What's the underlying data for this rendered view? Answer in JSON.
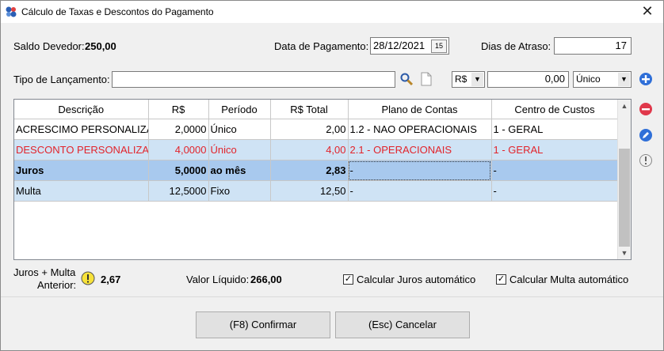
{
  "window": {
    "title": "Cálculo de Taxas e Descontos do Pagamento"
  },
  "header": {
    "saldo_label": "Saldo Devedor:",
    "saldo_value": "250,00",
    "data_label": "Data de Pagamento:",
    "data_value": "28/12/2021",
    "cal_day": "15",
    "dias_label": "Dias de Atraso:",
    "dias_value": "17"
  },
  "tipo": {
    "label": "Tipo de Lançamento:",
    "value": "",
    "currency": "R$",
    "amount": "0,00",
    "period": "Único"
  },
  "table": {
    "columns": [
      "Descrição",
      "R$",
      "Período",
      "R$ Total",
      "Plano de Contas",
      "Centro de Custos"
    ],
    "rows": [
      [
        "ACRESCIMO PERSONALIZA",
        "2,0000",
        "Único",
        "2,00",
        "1.2 - NAO OPERACIONAIS",
        "1 - GERAL"
      ],
      [
        "DESCONTO PERSONALIZA",
        "4,0000",
        "Único",
        "4,00",
        "2.1 - OPERACIONAIS",
        "1 - GERAL"
      ],
      [
        "Juros",
        "5,0000",
        "ao mês",
        "2,83",
        "-",
        "-"
      ],
      [
        "Multa",
        "12,5000",
        "Fixo",
        "12,50",
        "-",
        "-"
      ]
    ]
  },
  "footer": {
    "juros_multa_label_1": "Juros + Multa",
    "juros_multa_label_2": "Anterior:",
    "juros_multa_value": "2,67",
    "liquido_label": "Valor Líquido:",
    "liquido_value": "266,00",
    "calc_juros_label": "Calcular Juros automático",
    "calc_multa_label": "Calcular Multa automático"
  },
  "buttons": {
    "confirm": "(F8) Confirmar",
    "cancel": "(Esc) Cancelar"
  },
  "colors": {
    "red_row": "#e2242b",
    "selected_row": "#a8c9ee",
    "alt_row": "#cfe3f5",
    "add_icon": "#2f6fd8",
    "remove_icon": "#e0384b"
  }
}
